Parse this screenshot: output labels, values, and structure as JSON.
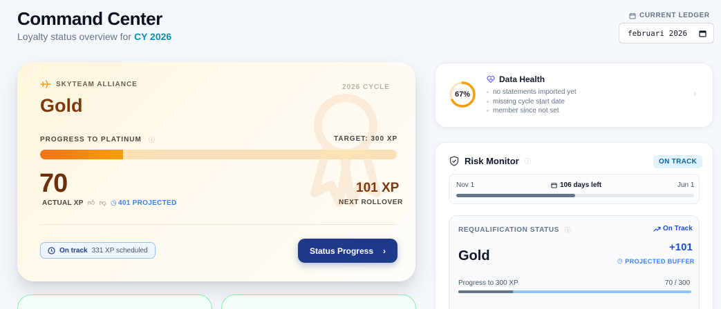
{
  "header": {
    "title": "Command Center",
    "subtitle": "Loyalty status overview for",
    "year": "CY 2026",
    "ledger_label": "CURRENT LEDGER",
    "ledger_value": "februari 2026"
  },
  "status_card": {
    "alliance": "SKYTEAM ALLIANCE",
    "tier": "Gold",
    "cycle": "2026 CYCLE",
    "progress_label": "PROGRESS TO PLATINUM",
    "target": "TARGET: 300 XP",
    "progress_fraction": 0.233,
    "actual_xp": "70",
    "actual_xp_label": "ACTUAL XP",
    "projected": "401 PROJECTED",
    "rollover_value": "101 XP",
    "rollover_label": "NEXT ROLLOVER",
    "on_track": "On track",
    "scheduled": "331 XP scheduled",
    "button": "Status Progress"
  },
  "health": {
    "percent": "67%",
    "percent_value": 0.67,
    "title": "Data Health",
    "items": [
      "no statements imported yet",
      "missing cycle start date",
      "member since not set"
    ]
  },
  "risk": {
    "title": "Risk Monitor",
    "badge": "ON TRACK",
    "timeline_start": "Nov 1",
    "timeline_mid": "106 days left",
    "timeline_end": "Jun 1",
    "timeline_fraction": 0.5,
    "req_label": "REQUALIFICATION STATUS",
    "req_trend": "On Track",
    "req_tier": "Gold",
    "req_buffer": "+101",
    "req_buffer_label": "PROJECTED BUFFER",
    "req_progress_label": "Progress to 300 XP",
    "req_progress_value": "70 / 300",
    "req_fraction": 0.233
  },
  "colors": {
    "accent": "#1e3a8a",
    "gold_text": "#7c3a0c",
    "progress_fill": "#f97316",
    "ring": "#f59e0b"
  }
}
